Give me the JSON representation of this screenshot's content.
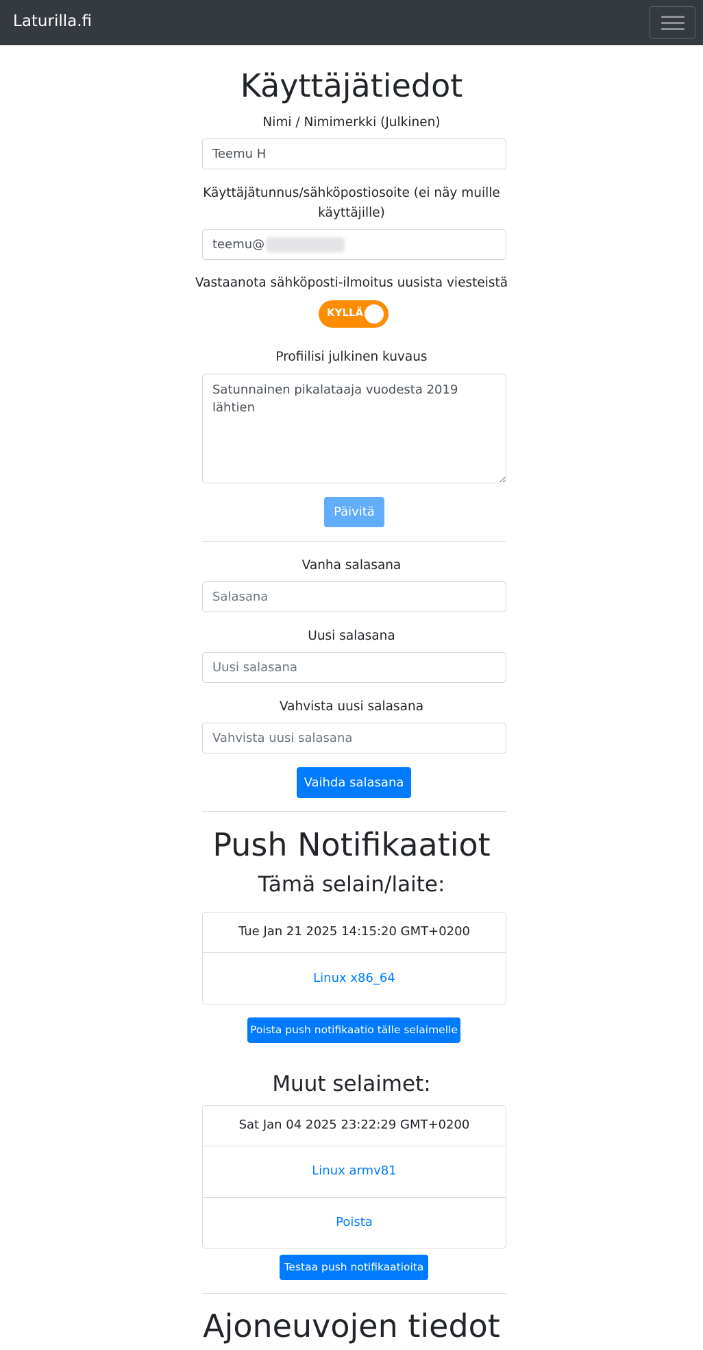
{
  "navbar": {
    "brand": "Laturilla.fi",
    "menu_icon": "hamburger-menu-icon"
  },
  "user_info": {
    "title": "Käyttäjätiedot",
    "name_label": "Nimi / Nimimerkki (Julkinen)",
    "name_value": "Teemu H",
    "email_label_line1": "Käyttäjätunnus/sähköpostiosoite (ei näy muille",
    "email_label_line2": "käyttäjille)",
    "email_value_visible": "teemu@",
    "notify_label": "Vastaanota sähköposti-ilmoitus uusista viesteistä",
    "notify_toggle_text": "KYLLÄ",
    "notify_toggle_on": true,
    "profile_label": "Profiilisi julkinen kuvaus",
    "profile_value": "Satunnainen pikalataaja vuodesta 2019 lähtien",
    "update_button": "Päivitä"
  },
  "password": {
    "old_label": "Vanha salasana",
    "old_placeholder": "Salasana",
    "new_label": "Uusi salasana",
    "new_placeholder": "Uusi salasana",
    "confirm_label": "Vahvista uusi salasana",
    "confirm_placeholder": "Vahvista uusi salasana",
    "change_button": "Vaihda salasana"
  },
  "push": {
    "title": "Push Notifikaatiot",
    "this_browser_title": "Tämä selain/laite:",
    "this_browser": {
      "date": "Tue Jan 21 2025 14:15:20 GMT+0200",
      "platform": "Linux x86_64"
    },
    "remove_this_button": "Poista push notifikaatio tälle selaimelle",
    "other_browsers_title": "Muut selaimet:",
    "other_browsers": [
      {
        "date": "Sat Jan 04 2025 23:22:29 GMT+0200",
        "platform": "Linux armv81",
        "remove_label": "Poista"
      }
    ],
    "test_button": "Testaa push notifikaatioita"
  },
  "vehicles": {
    "title": "Ajoneuvojen tiedot"
  },
  "colors": {
    "navbar": "#343a40",
    "primary": "#007bff",
    "toggle": "#fd8c00"
  }
}
